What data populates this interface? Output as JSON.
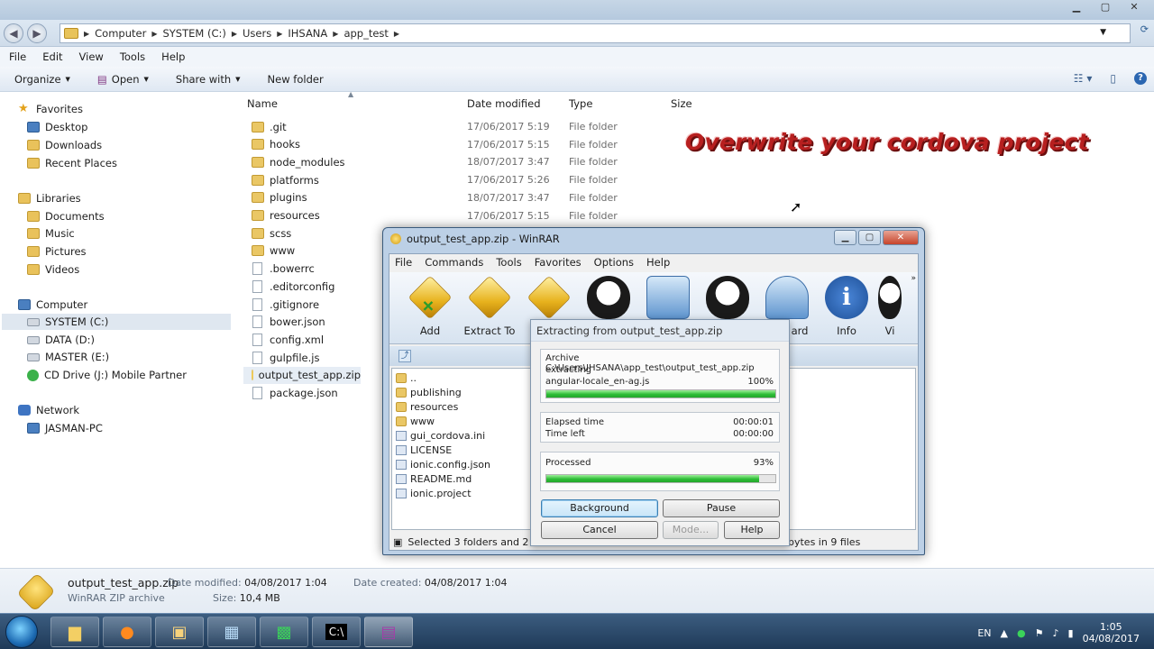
{
  "explorer": {
    "breadcrumb": [
      "Computer",
      "SYSTEM (C:)",
      "Users",
      "IHSANA",
      "app_test"
    ],
    "menu": [
      "File",
      "Edit",
      "View",
      "Tools",
      "Help"
    ],
    "commands": {
      "organize": "Organize",
      "open": "Open",
      "share": "Share with",
      "new_folder": "New folder"
    },
    "nav": {
      "favorites": "Favorites",
      "desktop": "Desktop",
      "downloads": "Downloads",
      "recent": "Recent Places",
      "libraries": "Libraries",
      "documents": "Documents",
      "music": "Music",
      "pictures": "Pictures",
      "videos": "Videos",
      "computer": "Computer",
      "system_c": "SYSTEM (C:)",
      "data_d": "DATA (D:)",
      "master_e": "MASTER (E:)",
      "cd_drive": "CD Drive (J:) Mobile Partner",
      "network": "Network",
      "jasman": "JASMAN-PC"
    },
    "columns": {
      "name": "Name",
      "date": "Date modified",
      "type": "Type",
      "size": "Size"
    },
    "files": [
      {
        "name": ".git",
        "date": "17/06/2017 5:19",
        "type": "File folder"
      },
      {
        "name": "hooks",
        "date": "17/06/2017 5:15",
        "type": "File folder"
      },
      {
        "name": "node_modules",
        "date": "18/07/2017 3:47",
        "type": "File folder"
      },
      {
        "name": "platforms",
        "date": "17/06/2017 5:26",
        "type": "File folder"
      },
      {
        "name": "plugins",
        "date": "18/07/2017 3:47",
        "type": "File folder"
      },
      {
        "name": "resources",
        "date": "17/06/2017 5:15",
        "type": "File folder"
      },
      {
        "name": "scss",
        "date": "",
        "type": ""
      },
      {
        "name": "www",
        "date": "",
        "type": ""
      },
      {
        "name": ".bowerrc",
        "date": "",
        "type": ""
      },
      {
        "name": ".editorconfig",
        "date": "",
        "type": ""
      },
      {
        "name": ".gitignore",
        "date": "",
        "type": ""
      },
      {
        "name": "bower.json",
        "date": "",
        "type": ""
      },
      {
        "name": "config.xml",
        "date": "",
        "type": ""
      },
      {
        "name": "gulpfile.js",
        "date": "",
        "type": ""
      },
      {
        "name": "output_test_app.zip",
        "date": "",
        "type": ""
      },
      {
        "name": "package.json",
        "date": "",
        "type": ""
      }
    ],
    "overlay": "Overwrite your cordova project",
    "details": {
      "name": "output_test_app.zip",
      "kind": "WinRAR ZIP archive",
      "modified_label": "Date modified:",
      "modified": "04/08/2017 1:04",
      "size_label": "Size:",
      "size": "10,4 MB",
      "created_label": "Date created:",
      "created": "04/08/2017 1:04"
    }
  },
  "taskbar": {
    "lang": "EN",
    "time": "1:05",
    "date": "04/08/2017"
  },
  "winrar": {
    "title": "output_test_app.zip - WinRAR",
    "menu": [
      "File",
      "Commands",
      "Tools",
      "Favorites",
      "Options",
      "Help"
    ],
    "tools": {
      "add": "Add",
      "extract": "Extract To",
      "wizard": "ard",
      "info": "Info",
      "vir": "Vi"
    },
    "list": [
      "..",
      "publishing",
      "resources",
      "www",
      "gui_cordova.ini",
      "LICENSE",
      "ionic.config.json",
      "README.md",
      "ionic.project"
    ],
    "status_left": "Selected 3 folders and 2",
    "status_right": "bytes in 9 files"
  },
  "dialog": {
    "title": "Extracting from output_test_app.zip",
    "archive": "Archive C:\\Users\\IHSANA\\app_test\\output_test_app.zip",
    "action": "extracting",
    "file": "angular-locale_en-ag.js",
    "file_pct": "100%",
    "file_progress": 1.0,
    "elapsed_label": "Elapsed time",
    "elapsed": "00:00:01",
    "left_label": "Time left",
    "left": "00:00:00",
    "processed_label": "Processed",
    "processed_pct": "93%",
    "processed_progress": 0.93,
    "buttons": {
      "background": "Background",
      "pause": "Pause",
      "cancel": "Cancel",
      "mode": "Mode...",
      "help": "Help"
    }
  }
}
